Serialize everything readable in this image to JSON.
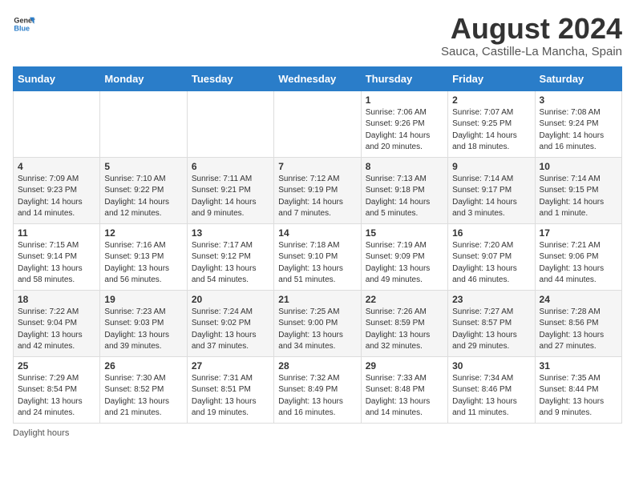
{
  "header": {
    "logo_general": "General",
    "logo_blue": "Blue",
    "title": "August 2024",
    "subtitle": "Sauca, Castille-La Mancha, Spain"
  },
  "weekdays": [
    "Sunday",
    "Monday",
    "Tuesday",
    "Wednesday",
    "Thursday",
    "Friday",
    "Saturday"
  ],
  "weeks": [
    [
      {
        "day": "",
        "info": ""
      },
      {
        "day": "",
        "info": ""
      },
      {
        "day": "",
        "info": ""
      },
      {
        "day": "",
        "info": ""
      },
      {
        "day": "1",
        "info": "Sunrise: 7:06 AM\nSunset: 9:26 PM\nDaylight: 14 hours and 20 minutes."
      },
      {
        "day": "2",
        "info": "Sunrise: 7:07 AM\nSunset: 9:25 PM\nDaylight: 14 hours and 18 minutes."
      },
      {
        "day": "3",
        "info": "Sunrise: 7:08 AM\nSunset: 9:24 PM\nDaylight: 14 hours and 16 minutes."
      }
    ],
    [
      {
        "day": "4",
        "info": "Sunrise: 7:09 AM\nSunset: 9:23 PM\nDaylight: 14 hours and 14 minutes."
      },
      {
        "day": "5",
        "info": "Sunrise: 7:10 AM\nSunset: 9:22 PM\nDaylight: 14 hours and 12 minutes."
      },
      {
        "day": "6",
        "info": "Sunrise: 7:11 AM\nSunset: 9:21 PM\nDaylight: 14 hours and 9 minutes."
      },
      {
        "day": "7",
        "info": "Sunrise: 7:12 AM\nSunset: 9:19 PM\nDaylight: 14 hours and 7 minutes."
      },
      {
        "day": "8",
        "info": "Sunrise: 7:13 AM\nSunset: 9:18 PM\nDaylight: 14 hours and 5 minutes."
      },
      {
        "day": "9",
        "info": "Sunrise: 7:14 AM\nSunset: 9:17 PM\nDaylight: 14 hours and 3 minutes."
      },
      {
        "day": "10",
        "info": "Sunrise: 7:14 AM\nSunset: 9:15 PM\nDaylight: 14 hours and 1 minute."
      }
    ],
    [
      {
        "day": "11",
        "info": "Sunrise: 7:15 AM\nSunset: 9:14 PM\nDaylight: 13 hours and 58 minutes."
      },
      {
        "day": "12",
        "info": "Sunrise: 7:16 AM\nSunset: 9:13 PM\nDaylight: 13 hours and 56 minutes."
      },
      {
        "day": "13",
        "info": "Sunrise: 7:17 AM\nSunset: 9:12 PM\nDaylight: 13 hours and 54 minutes."
      },
      {
        "day": "14",
        "info": "Sunrise: 7:18 AM\nSunset: 9:10 PM\nDaylight: 13 hours and 51 minutes."
      },
      {
        "day": "15",
        "info": "Sunrise: 7:19 AM\nSunset: 9:09 PM\nDaylight: 13 hours and 49 minutes."
      },
      {
        "day": "16",
        "info": "Sunrise: 7:20 AM\nSunset: 9:07 PM\nDaylight: 13 hours and 46 minutes."
      },
      {
        "day": "17",
        "info": "Sunrise: 7:21 AM\nSunset: 9:06 PM\nDaylight: 13 hours and 44 minutes."
      }
    ],
    [
      {
        "day": "18",
        "info": "Sunrise: 7:22 AM\nSunset: 9:04 PM\nDaylight: 13 hours and 42 minutes."
      },
      {
        "day": "19",
        "info": "Sunrise: 7:23 AM\nSunset: 9:03 PM\nDaylight: 13 hours and 39 minutes."
      },
      {
        "day": "20",
        "info": "Sunrise: 7:24 AM\nSunset: 9:02 PM\nDaylight: 13 hours and 37 minutes."
      },
      {
        "day": "21",
        "info": "Sunrise: 7:25 AM\nSunset: 9:00 PM\nDaylight: 13 hours and 34 minutes."
      },
      {
        "day": "22",
        "info": "Sunrise: 7:26 AM\nSunset: 8:59 PM\nDaylight: 13 hours and 32 minutes."
      },
      {
        "day": "23",
        "info": "Sunrise: 7:27 AM\nSunset: 8:57 PM\nDaylight: 13 hours and 29 minutes."
      },
      {
        "day": "24",
        "info": "Sunrise: 7:28 AM\nSunset: 8:56 PM\nDaylight: 13 hours and 27 minutes."
      }
    ],
    [
      {
        "day": "25",
        "info": "Sunrise: 7:29 AM\nSunset: 8:54 PM\nDaylight: 13 hours and 24 minutes."
      },
      {
        "day": "26",
        "info": "Sunrise: 7:30 AM\nSunset: 8:52 PM\nDaylight: 13 hours and 21 minutes."
      },
      {
        "day": "27",
        "info": "Sunrise: 7:31 AM\nSunset: 8:51 PM\nDaylight: 13 hours and 19 minutes."
      },
      {
        "day": "28",
        "info": "Sunrise: 7:32 AM\nSunset: 8:49 PM\nDaylight: 13 hours and 16 minutes."
      },
      {
        "day": "29",
        "info": "Sunrise: 7:33 AM\nSunset: 8:48 PM\nDaylight: 13 hours and 14 minutes."
      },
      {
        "day": "30",
        "info": "Sunrise: 7:34 AM\nSunset: 8:46 PM\nDaylight: 13 hours and 11 minutes."
      },
      {
        "day": "31",
        "info": "Sunrise: 7:35 AM\nSunset: 8:44 PM\nDaylight: 13 hours and 9 minutes."
      }
    ]
  ],
  "footer": {
    "note": "Daylight hours"
  }
}
